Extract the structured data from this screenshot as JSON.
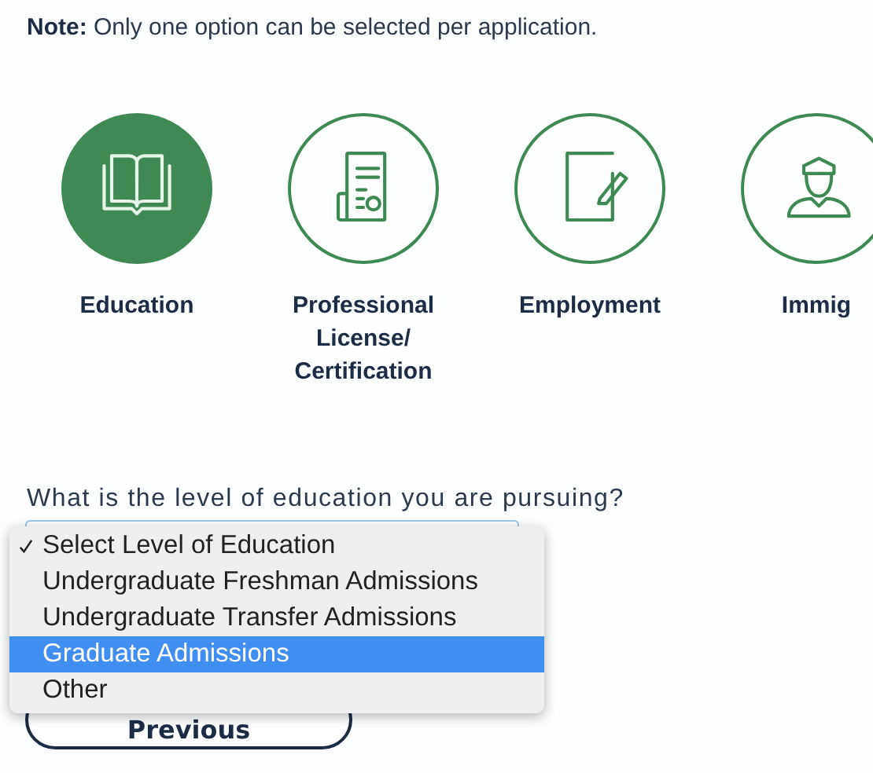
{
  "note": "**Note:** Only one option can be selected per application.",
  "categories": [
    {
      "label": "Education",
      "kind": "book",
      "selected": true
    },
    {
      "label": "Professional License/ Certification",
      "kind": "certificate",
      "selected": false
    },
    {
      "label": "Employment",
      "kind": "document-pen",
      "selected": false
    },
    {
      "label": "Immig",
      "kind": "person",
      "selected": false
    }
  ],
  "question": "What is the level of education you are pursuing?",
  "dropdown": {
    "options": [
      {
        "label": "Select Level of Education",
        "checked": true,
        "highlighted": false
      },
      {
        "label": "Undergraduate Freshman Admissions",
        "checked": false,
        "highlighted": false
      },
      {
        "label": "Undergraduate Transfer Admissions",
        "checked": false,
        "highlighted": false
      },
      {
        "label": "Graduate Admissions",
        "checked": false,
        "highlighted": true
      },
      {
        "label": "Other",
        "checked": false,
        "highlighted": false
      }
    ]
  },
  "buttons": [
    {
      "label": "Previous"
    }
  ]
}
